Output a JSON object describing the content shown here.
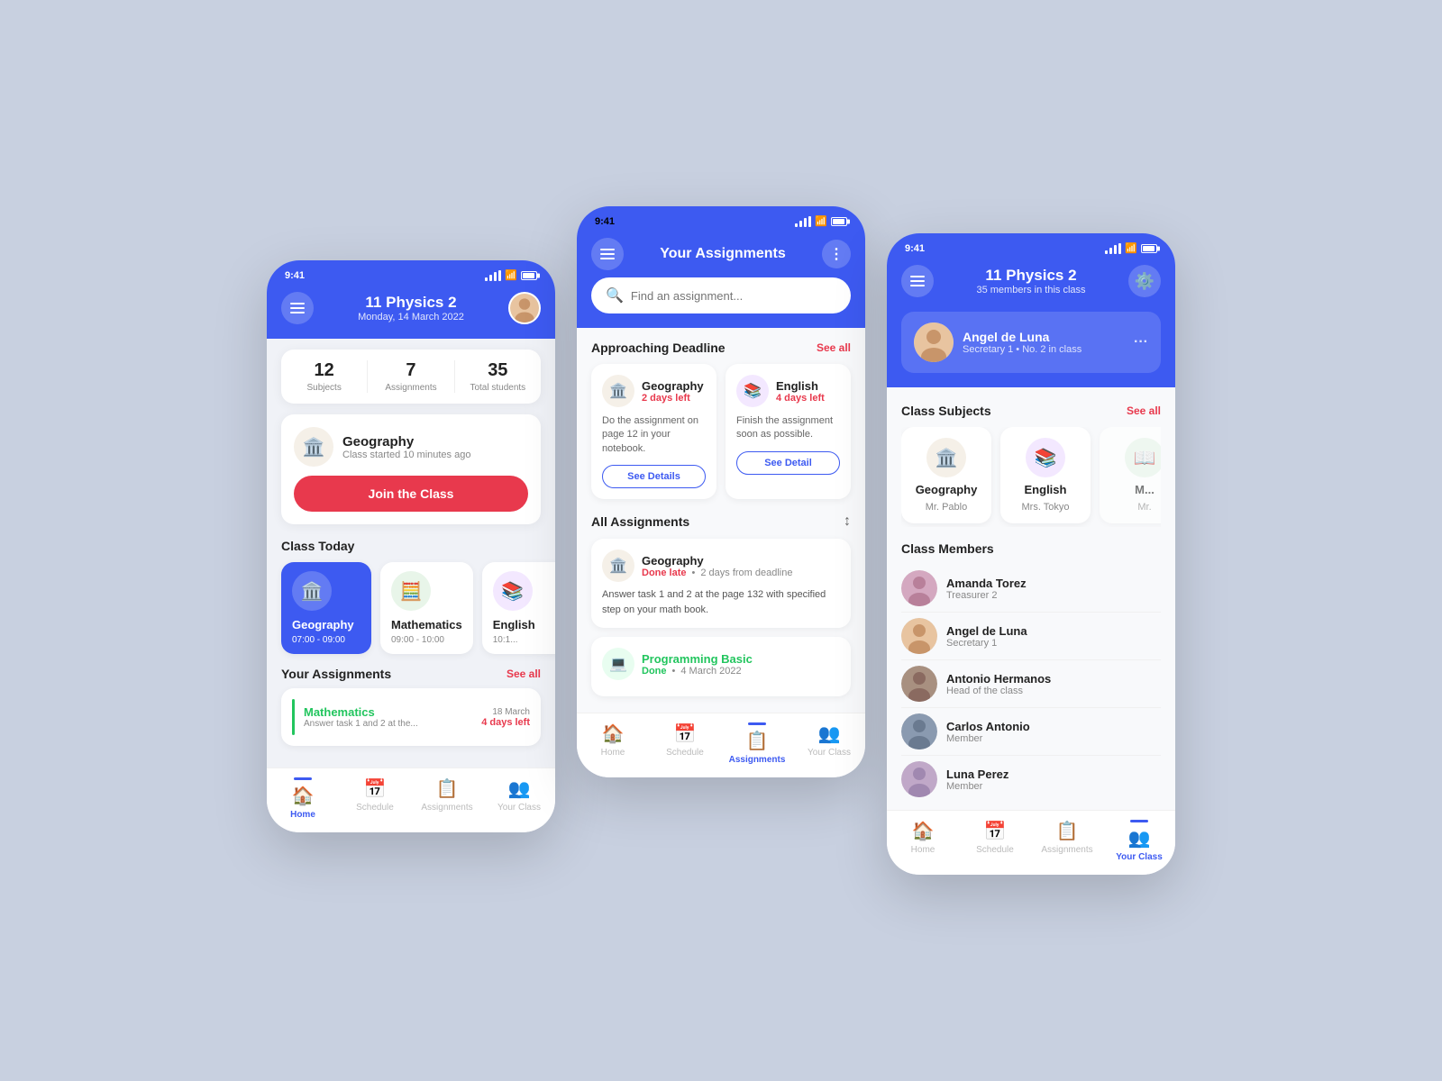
{
  "phone1": {
    "statusBar": {
      "time": "9:41"
    },
    "header": {
      "title": "11 Physics 2",
      "subtitle": "Monday, 14 March 2022"
    },
    "stats": [
      {
        "value": "12",
        "label": "Subjects"
      },
      {
        "value": "7",
        "label": "Assignments"
      },
      {
        "value": "35",
        "label": "Total students"
      }
    ],
    "classCard": {
      "subject": "Geography",
      "status": "Class started 10 minutes ago",
      "joinBtn": "Join the Class"
    },
    "classToday": {
      "title": "Class Today",
      "items": [
        {
          "name": "Geography",
          "time": "07:00 - 09:00",
          "active": true
        },
        {
          "name": "Mathematics",
          "time": "09:00 - 10:00",
          "active": false
        },
        {
          "name": "English",
          "time": "10:1...",
          "active": false
        }
      ]
    },
    "assignments": {
      "title": "Your Assignments",
      "seeAll": "See all",
      "items": [
        {
          "subject": "Mathematics",
          "desc": "Answer task 1 and 2 at the...",
          "date": "18 March",
          "daysLeft": "4 days left"
        }
      ]
    },
    "nav": [
      {
        "icon": "🏠",
        "label": "Home",
        "active": true
      },
      {
        "icon": "📅",
        "label": "Schedule",
        "active": false
      },
      {
        "icon": "📋",
        "label": "Assignments",
        "active": false
      },
      {
        "icon": "👥",
        "label": "Your Class",
        "active": false
      }
    ]
  },
  "phone2": {
    "statusBar": {
      "time": "9:41"
    },
    "header": {
      "title": "Your Assignments"
    },
    "search": {
      "placeholder": "Find an assignment..."
    },
    "approachingDeadline": {
      "title": "Approaching Deadline",
      "seeAll": "See all",
      "cards": [
        {
          "subject": "Geography",
          "daysLeft": "2 days left",
          "desc": "Do the assignment on page 12 in your notebook.",
          "btnLabel": "See Details"
        },
        {
          "subject": "English",
          "daysLeft": "4 days left",
          "desc": "Finish the assignment soon as possible.",
          "btnLabel": "See Detail"
        }
      ]
    },
    "allAssignments": {
      "title": "All Assignments",
      "items": [
        {
          "subject": "Geography",
          "status": "Done late",
          "deadline": "2 days from deadline",
          "desc": "Answer task 1 and 2 at the page 132 with specified step on your math book.",
          "statusType": "late"
        },
        {
          "subject": "Programming Basic",
          "status": "Done",
          "deadline": "4 March 2022",
          "desc": "",
          "statusType": "done"
        }
      ]
    },
    "nav": [
      {
        "icon": "🏠",
        "label": "Home",
        "active": false
      },
      {
        "icon": "📅",
        "label": "Schedule",
        "active": false
      },
      {
        "icon": "📋",
        "label": "Assignments",
        "active": true
      },
      {
        "icon": "👥",
        "label": "Your Class",
        "active": false
      }
    ]
  },
  "phone3": {
    "statusBar": {
      "time": "9:41"
    },
    "header": {
      "title": "11 Physics 2",
      "subtitle": "35 members in this class"
    },
    "userCard": {
      "name": "Angel de Luna",
      "role": "Secretary 1  •  No. 2 in class"
    },
    "classSubjects": {
      "title": "Class Subjects",
      "seeAll": "See all",
      "items": [
        {
          "name": "Geography",
          "teacher": "Mr. Pablo"
        },
        {
          "name": "English",
          "teacher": "Mrs. Tokyo"
        },
        {
          "name": "M...",
          "teacher": "Mr."
        }
      ]
    },
    "classMembers": {
      "title": "Class Members",
      "items": [
        {
          "name": "Amanda Torez",
          "role": "Treasurer 2"
        },
        {
          "name": "Angel de Luna",
          "role": "Secretary 1"
        },
        {
          "name": "Antonio Hermanos",
          "role": "Head of the class"
        },
        {
          "name": "Carlos Antonio",
          "role": "Member"
        },
        {
          "name": "Luna Perez",
          "role": "Member"
        }
      ]
    },
    "nav": [
      {
        "icon": "🏠",
        "label": "Home",
        "active": false
      },
      {
        "icon": "📅",
        "label": "Schedule",
        "active": false
      },
      {
        "icon": "📋",
        "label": "Assignments",
        "active": false
      },
      {
        "icon": "👥",
        "label": "Your Class",
        "active": true
      }
    ]
  }
}
